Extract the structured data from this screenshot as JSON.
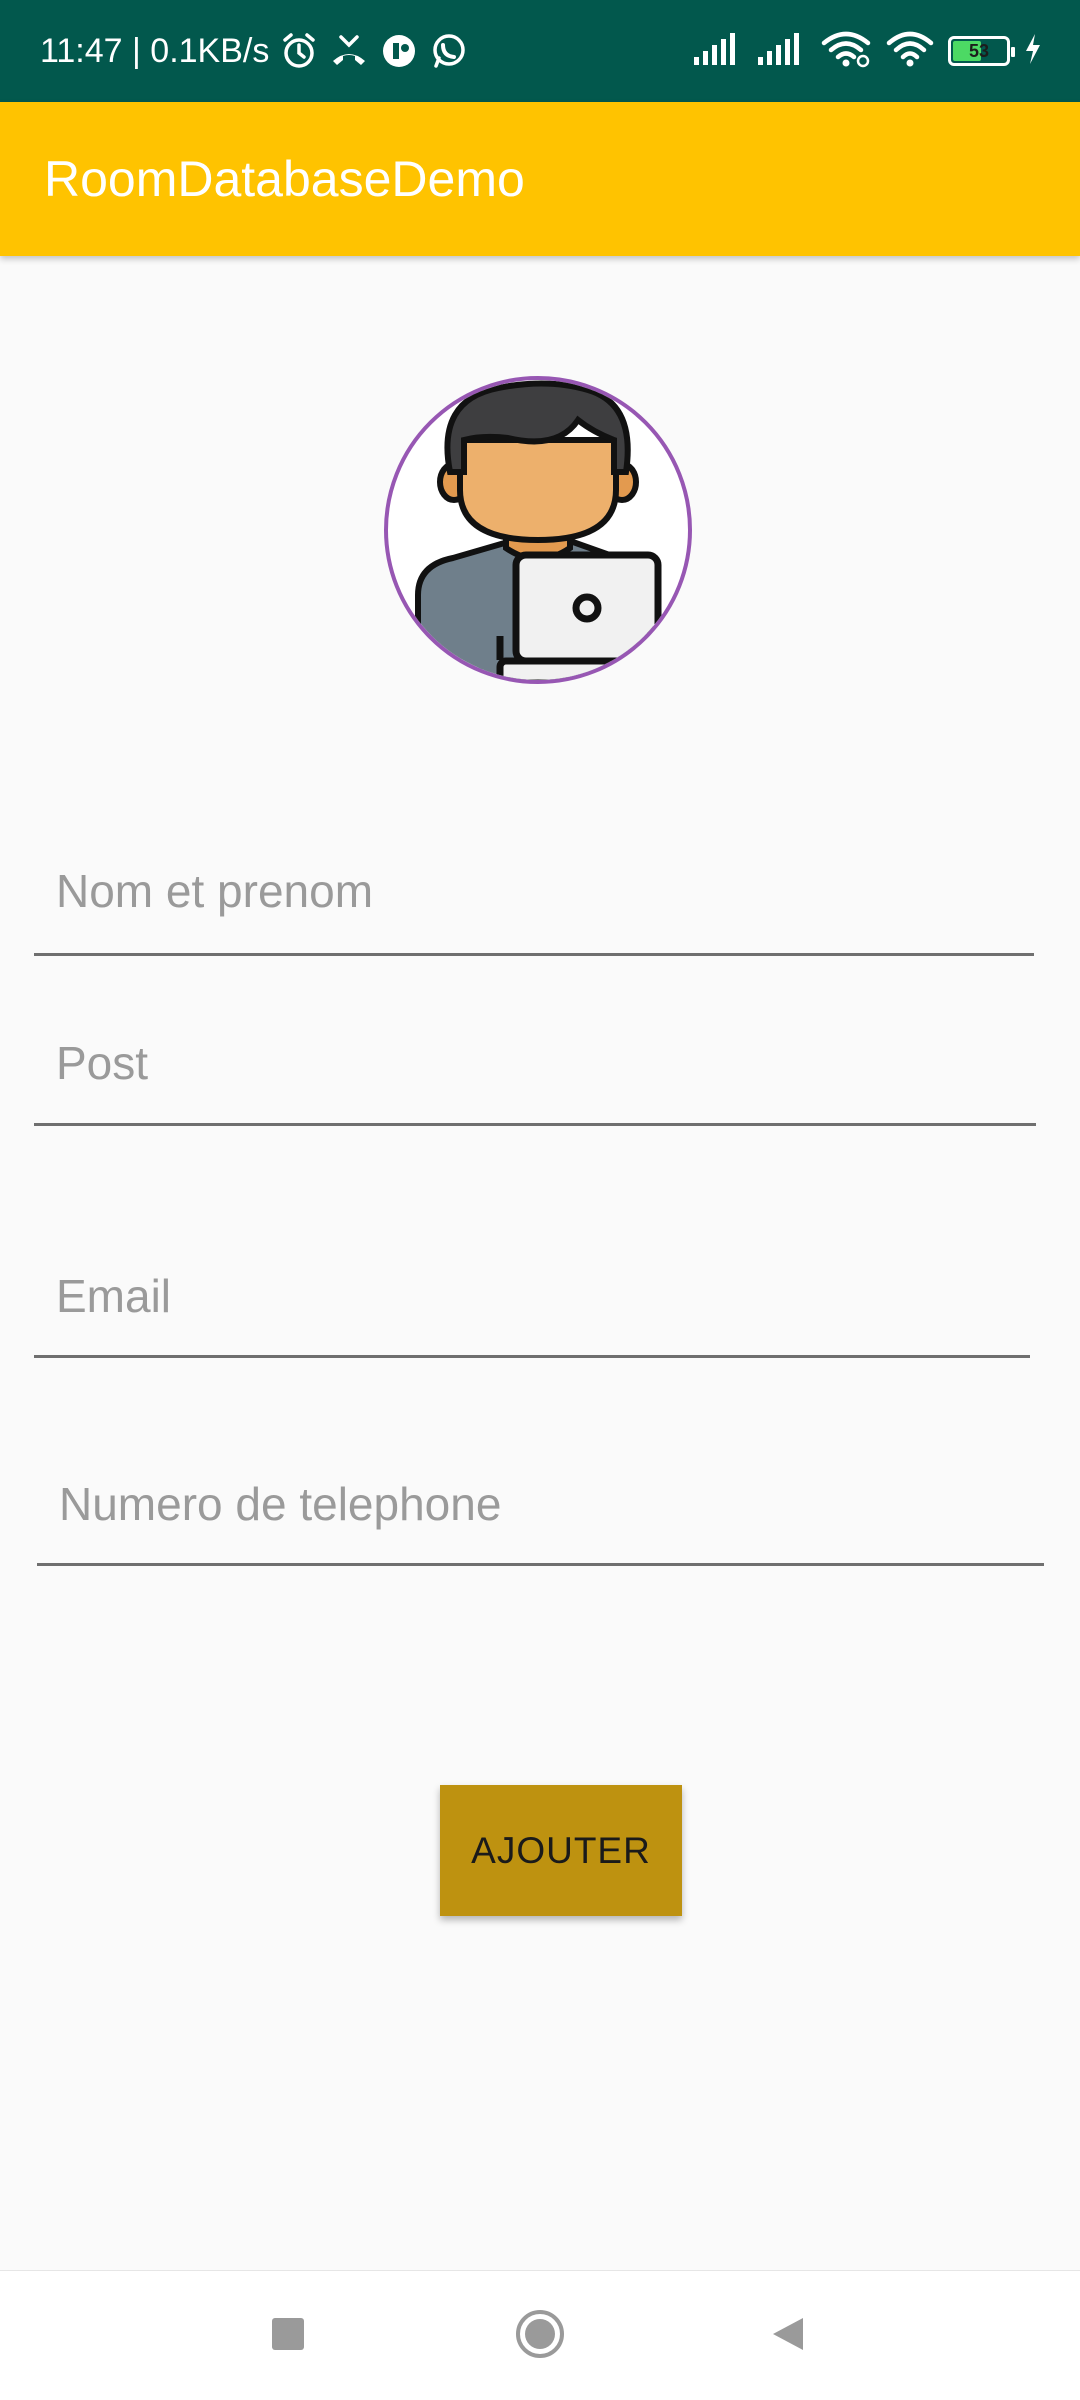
{
  "status_bar": {
    "time_speed": "11:47 | 0.1KB/s",
    "battery_level": "53",
    "battery_fraction": 0.53,
    "icons": [
      "alarm-icon",
      "missed-call-icon",
      "app-notification-icon",
      "whatsapp-icon",
      "signal-icon",
      "signal-icon",
      "wifi-icon",
      "wifi-icon",
      "battery-icon",
      "charging-icon"
    ]
  },
  "app_bar": {
    "title": "RoomDatabaseDemo"
  },
  "form": {
    "name_placeholder": "Nom et prenom",
    "post_placeholder": "Post",
    "email_placeholder": "Email",
    "phone_placeholder": "Numero de telephone",
    "submit_label": "AJOUTER"
  },
  "colors": {
    "status_bar": "#02584d",
    "app_bar": "#ffc300",
    "button": "#be9210",
    "avatar_border": "#9757b3"
  },
  "nav_bar": {
    "icons": [
      "recents-square-icon",
      "home-circle-icon",
      "back-triangle-icon"
    ]
  }
}
